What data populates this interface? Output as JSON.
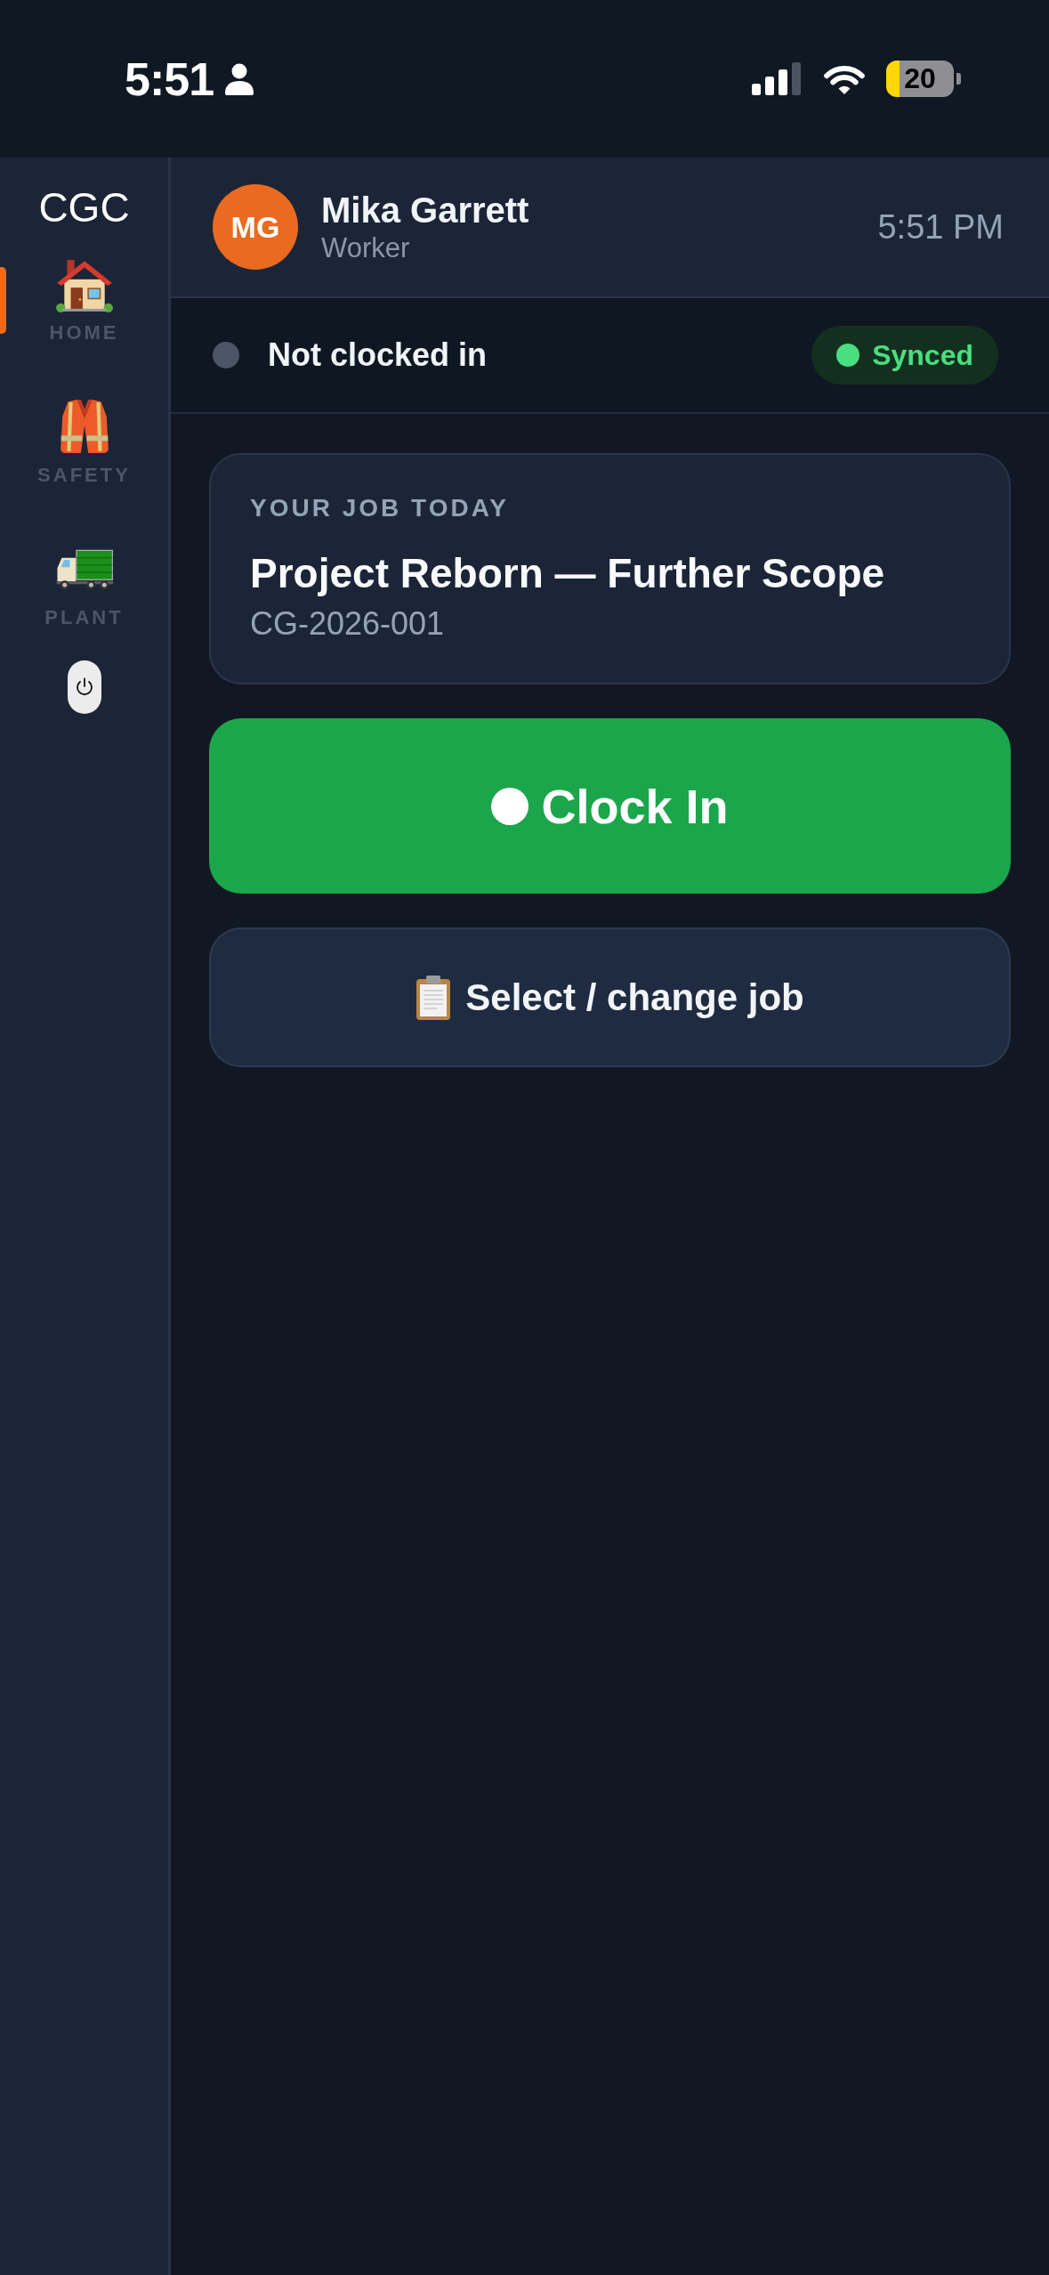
{
  "status_bar": {
    "time": "5:51",
    "battery": "20"
  },
  "sidebar": {
    "logo": "CGC",
    "items": [
      {
        "kind": "home",
        "label": "HOME",
        "selected": true
      },
      {
        "kind": "safety",
        "label": "SAFETY",
        "selected": false
      },
      {
        "kind": "plant",
        "label": "PLANT",
        "selected": false
      }
    ]
  },
  "header": {
    "initials": "MG",
    "name": "Mika Garrett",
    "role": "Worker",
    "time": "5:51 PM"
  },
  "clock_status": {
    "label": "Not clocked in",
    "clocked_in": false,
    "sync": {
      "label": "Synced",
      "synced": true
    }
  },
  "job_card": {
    "heading": "YOUR JOB TODAY",
    "title": "Project Reborn — Further Scope",
    "code": "CG-2026-001"
  },
  "actions": [
    {
      "kind": "primary",
      "label": "Clock In"
    },
    {
      "kind": "secondary",
      "label": "Select / change job"
    }
  ]
}
